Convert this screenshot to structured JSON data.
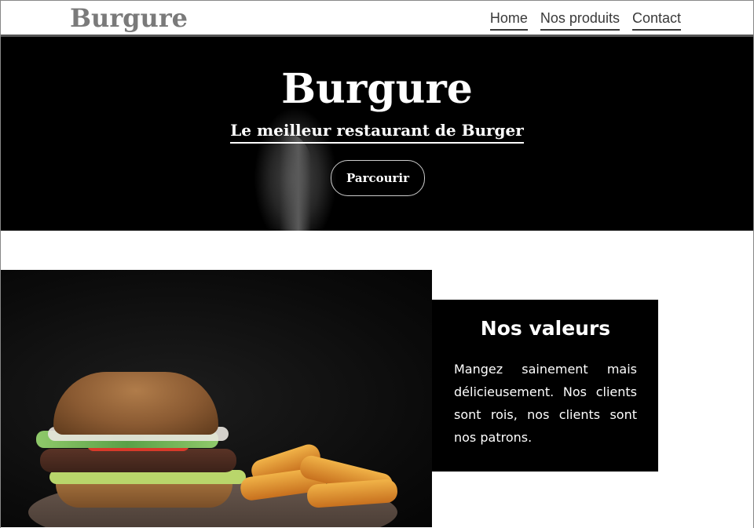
{
  "header": {
    "logo": "Burgure",
    "nav": [
      "Home",
      "Nos produits",
      "Contact"
    ]
  },
  "hero": {
    "title": "Burgure",
    "subtitle": "Le meilleur restaurant de Burger",
    "button": "Parcourir"
  },
  "values": {
    "title": "Nos valeurs",
    "text": "Mangez sainement mais délicieusement. Nos clients sont rois, nos clients sont nos patrons."
  },
  "colors": {
    "hero_bg": "#000000",
    "card_bg": "#000000",
    "logo": "#7a7a7a",
    "nav_text": "#3a3a3a"
  }
}
